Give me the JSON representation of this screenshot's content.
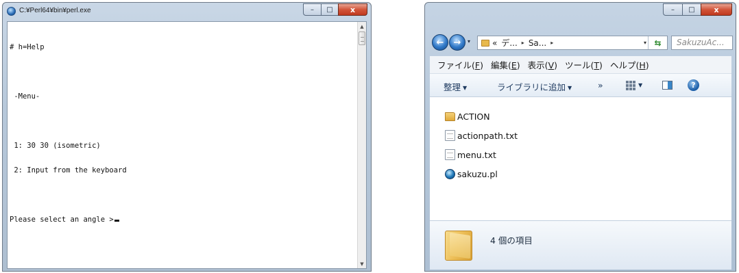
{
  "console": {
    "title": "C:¥Perl64¥bin¥perl.exe",
    "lines": [
      "# h=Help",
      "",
      " -Menu-",
      "",
      " 1: 30 30 (isometric)",
      " 2: Input from the keyboard",
      "",
      "Please select an angle >"
    ],
    "caption": {
      "minimize": "–",
      "maximize": "□",
      "close": "x"
    }
  },
  "explorer": {
    "caption": {
      "minimize": "–",
      "maximize": "□",
      "close": "x"
    },
    "nav": {
      "back": "←",
      "forward": "→",
      "dropdown": "▾"
    },
    "address": {
      "prefix": "«",
      "segments": [
        "デ...",
        "Sa..."
      ],
      "separator": "▸",
      "dropdown": "▾",
      "refresh": "⇆"
    },
    "search_text": "SakuzuAc...",
    "menu": [
      {
        "label": "ファイル(",
        "acc": "F",
        "end": ")"
      },
      {
        "label": "編集(",
        "acc": "E",
        "end": ")"
      },
      {
        "label": "表示(",
        "acc": "V",
        "end": ")"
      },
      {
        "label": "ツール(",
        "acc": "T",
        "end": ")"
      },
      {
        "label": "ヘルプ(",
        "acc": "H",
        "end": ")"
      }
    ],
    "commands": {
      "organize": "整理",
      "add_to_library": "ライブラリに追加",
      "more": "»",
      "dropdown": "▼",
      "help": "?"
    },
    "files": [
      {
        "name": "ACTION",
        "icon": "folder-icon"
      },
      {
        "name": "actionpath.txt",
        "icon": "text-file-icon"
      },
      {
        "name": "menu.txt",
        "icon": "text-file-icon"
      },
      {
        "name": "sakuzu.pl",
        "icon": "perl-script-icon"
      }
    ],
    "status": "4 個の項目"
  }
}
